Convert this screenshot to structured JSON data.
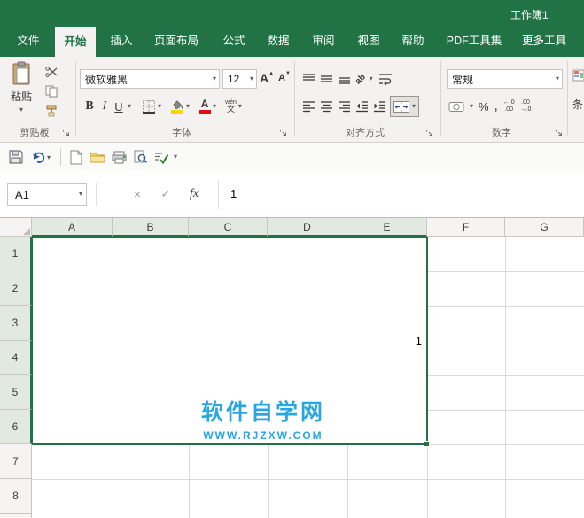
{
  "window": {
    "title": "工作簿1"
  },
  "tabs": {
    "items": [
      "文件",
      "开始",
      "插入",
      "页面布局",
      "公式",
      "数据",
      "审阅",
      "视图",
      "帮助",
      "PDF工具集",
      "更多工具"
    ]
  },
  "ribbon": {
    "clipboard": {
      "paste": "粘贴",
      "group": "剪贴板"
    },
    "font": {
      "family": "微软雅黑",
      "size": "12",
      "bold": "B",
      "italic": "I",
      "underline": "U",
      "grow": "A",
      "shrink": "A",
      "color_letter": "A",
      "phonetic_top": "wén",
      "phonetic_bottom": "文",
      "group": "字体"
    },
    "alignment": {
      "orientation": "ab",
      "group": "对齐方式"
    },
    "number": {
      "format": "常规",
      "percent": "%",
      "comma": ",",
      "inc_top": "←.0",
      "inc_bottom": ".00",
      "dec_top": ".00",
      "dec_bottom": "→.0",
      "group": "数字"
    },
    "styles": {
      "partial": "条"
    }
  },
  "formula_bar": {
    "name_box": "A1",
    "cancel": "×",
    "enter": "✓",
    "fx": "fx",
    "value": "1"
  },
  "sheet": {
    "columns": [
      "A",
      "B",
      "C",
      "D",
      "E",
      "F",
      "G"
    ],
    "rows": [
      "1",
      "2",
      "3",
      "4",
      "5",
      "6",
      "7",
      "8"
    ],
    "selection": {
      "range": "A1:E6",
      "merged_value": "1"
    },
    "watermark": {
      "line1": "软件自学网",
      "line2": "WWW.RJZXW.COM"
    }
  },
  "icons": {
    "dropdown": "▾",
    "up": "▲",
    "down": "▼"
  },
  "colors": {
    "excel_green": "#217346",
    "watermark_blue": "#27a7e0",
    "selection_border": "#217346"
  }
}
